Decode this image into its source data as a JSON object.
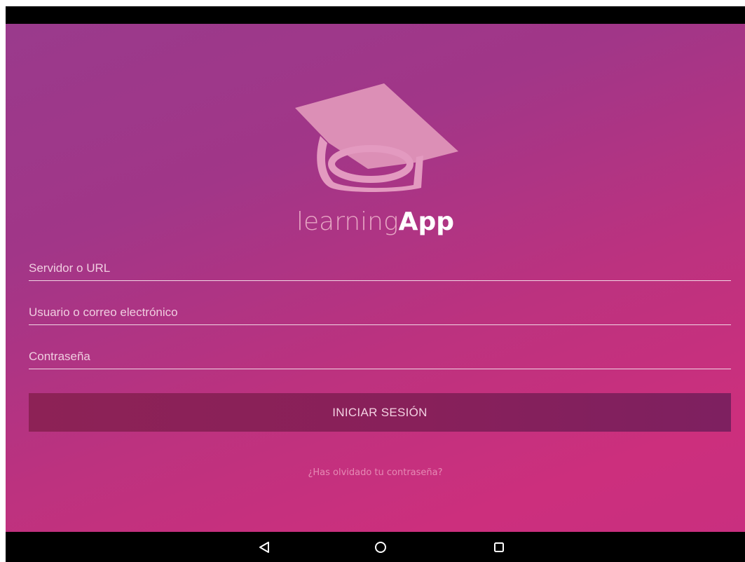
{
  "app": {
    "name_light": "learning",
    "name_bold": "App"
  },
  "form": {
    "server_placeholder": "Servidor o URL",
    "server_value": "",
    "user_placeholder": "Usuario o correo electrónico",
    "user_value": "",
    "password_placeholder": "Contraseña",
    "password_value": "",
    "login_label": "INICIAR SESIÓN",
    "forgot_label": "¿Has olvidado tu contraseña?"
  },
  "navigation": {
    "back_icon": "back-triangle-icon",
    "home_icon": "home-circle-icon",
    "recent_icon": "recent-square-icon"
  },
  "colors": {
    "gradient_top": "#9a3a8c",
    "gradient_bottom": "#cc2f7d",
    "button": "#88205a",
    "logo": "#e39ac0"
  }
}
